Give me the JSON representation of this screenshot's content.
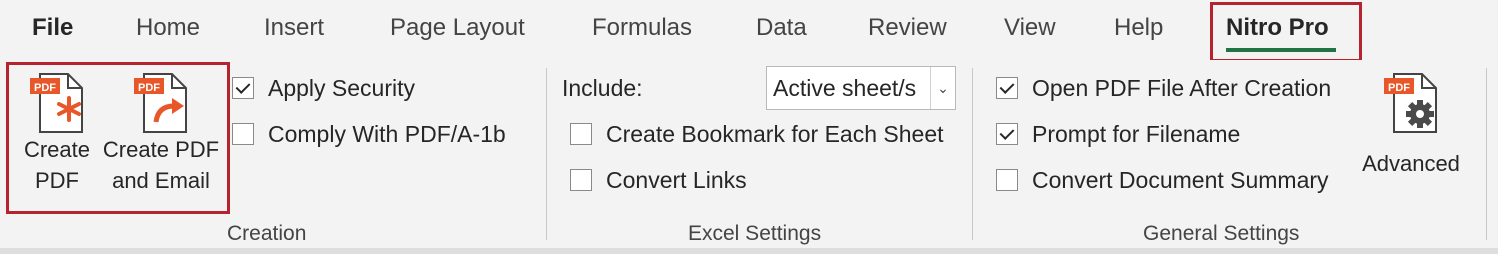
{
  "tabs": [
    {
      "label": "File"
    },
    {
      "label": "Home"
    },
    {
      "label": "Insert"
    },
    {
      "label": "Page Layout"
    },
    {
      "label": "Formulas"
    },
    {
      "label": "Data"
    },
    {
      "label": "Review"
    },
    {
      "label": "View"
    },
    {
      "label": "Help"
    },
    {
      "label": "Nitro Pro"
    }
  ],
  "active_tab": "Nitro Pro",
  "colors": {
    "accent": "#217346",
    "highlight": "#b5232f",
    "pdf_badge": "#e8572a"
  },
  "creation": {
    "create_pdf": {
      "line1": "Create",
      "line2": "PDF",
      "badge": "PDF",
      "icon": "create-pdf-icon"
    },
    "create_pdf_email": {
      "line1": "Create PDF",
      "line2": "and Email",
      "badge": "PDF",
      "icon": "pdf-email-arrow-icon"
    },
    "apply_security": {
      "label": "Apply Security",
      "checked": true
    },
    "comply_pdfa": {
      "label": "Comply With PDF/A-1b",
      "checked": false
    },
    "group_label": "Creation"
  },
  "excel_settings": {
    "include_label": "Include:",
    "include_value": "Active sheet/s",
    "create_bookmark": {
      "label": "Create Bookmark for Each Sheet",
      "checked": false
    },
    "convert_links": {
      "label": "Convert Links",
      "checked": false
    },
    "group_label": "Excel Settings"
  },
  "general_settings": {
    "open_pdf": {
      "label": "Open PDF File After Creation",
      "checked": true
    },
    "prompt_filename": {
      "label": "Prompt for Filename",
      "checked": true
    },
    "convert_summary": {
      "label": "Convert Document Summary",
      "checked": false
    },
    "advanced": {
      "label": "Advanced",
      "badge": "PDF",
      "icon": "gear-icon"
    },
    "group_label": "General Settings"
  }
}
